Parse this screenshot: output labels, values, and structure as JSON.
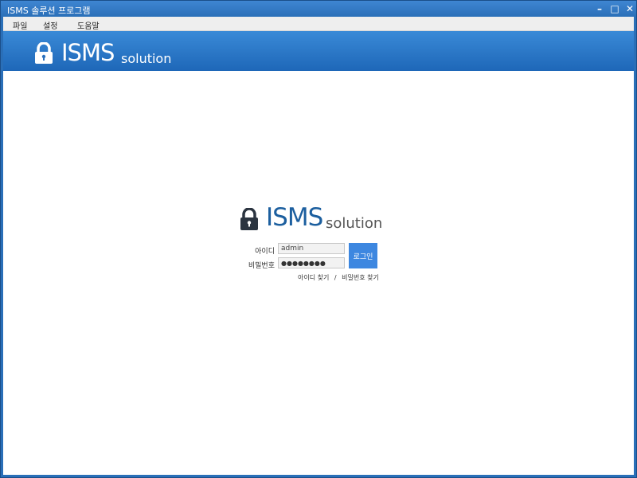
{
  "window": {
    "title": "ISMS 솔루션 프로그램",
    "controls": {
      "minimize": "–",
      "maximize": "□",
      "close": "✕"
    }
  },
  "menubar": {
    "items": [
      {
        "label": "파일"
      },
      {
        "label": "설정"
      },
      {
        "label": "도움말"
      }
    ]
  },
  "banner": {
    "brand_main": "ISMS",
    "brand_sub": "solution",
    "icon": "lock-icon"
  },
  "login": {
    "logo_main": "ISMS",
    "logo_sub": "solution",
    "id_label": "아이디",
    "id_value": "admin",
    "pw_label": "비밀번호",
    "pw_value": "●●●●●●●●",
    "login_button": "로그인",
    "find_id": "아이디 찾기",
    "separator": "/",
    "find_pw": "비밀번호 찾기"
  },
  "colors": {
    "banner": "#2a7acb",
    "logo_isms": "#1c5f9f",
    "login_button": "#3d87e0"
  }
}
